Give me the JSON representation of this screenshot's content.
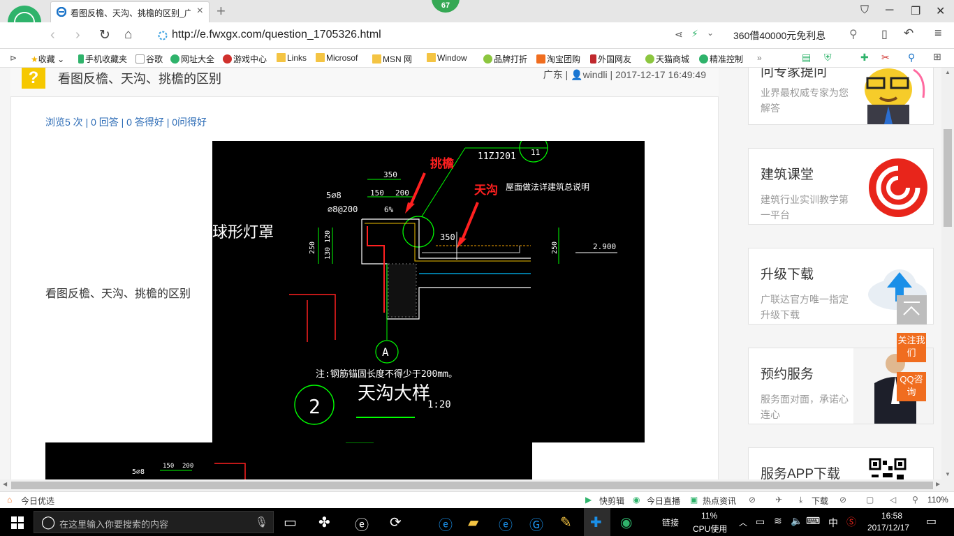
{
  "browser": {
    "tab_title": "看图反檐、天沟、挑檐的区别_广",
    "badge": "67",
    "url": "http://e.fwxgx.com/question_1705326.html",
    "search_ad": "360借40000元免利息"
  },
  "bookmarks": [
    {
      "label": "收藏"
    },
    {
      "label": "手机收藏夹"
    },
    {
      "label": "谷歌"
    },
    {
      "label": "网址大全"
    },
    {
      "label": "游戏中心"
    },
    {
      "label": "Links"
    },
    {
      "label": "Microsof"
    },
    {
      "label": "MSN 网"
    },
    {
      "label": "Window"
    },
    {
      "label": "品牌打折"
    },
    {
      "label": "淘宝团购"
    },
    {
      "label": "外国网友"
    },
    {
      "label": "天猫商城"
    },
    {
      "label": "精准控制"
    }
  ],
  "question": {
    "title": "看图反檐、天沟、挑檐的区别",
    "meta": "广东 | ",
    "author": "windli",
    "datetime": " | 2017-12-17 16:49:49",
    "stats": "浏览5 次 | 0 回答 | 0 答得好 | 0问得好",
    "body": "看图反檐、天沟、挑檐的区别"
  },
  "drawing": {
    "label_tiaoyan": "挑檐",
    "label_tiangou": "天沟",
    "note_roof": "屋面做法详建筑总说明",
    "std_ref": "11ZJ201",
    "ref_num": "11",
    "dim_350": "350",
    "dim_150": "150",
    "dim_200": "200",
    "rebar_1": "5⌀8",
    "rebar_2": "⌀8@200",
    "slope": "6%",
    "dim_120": "120",
    "dim_130": "130",
    "dim_250": "250",
    "dim_350b": "350",
    "dim_250b": "250",
    "elev": "2.900",
    "axis": "A",
    "note_anchor": "注:钢筋锚固长度不得少于200mm。",
    "detail_num": "2",
    "detail_title": "天沟大样",
    "scale": "1:20",
    "side_text": "球形灯罩",
    "b_rebar": "5⌀8",
    "b_150": "150",
    "b_200": "200"
  },
  "sidebar": {
    "expert_title": "问专家提问",
    "expert_sub": "业界最权威专家为您解答",
    "course_title": "建筑课堂",
    "course_sub": "建筑行业实训教学第一平台",
    "upgrade_title": "升级下载",
    "upgrade_sub": "广联达官方唯一指定升级下载",
    "booking_title": "预约服务",
    "booking_sub": "服务面对面，承诺心连心",
    "app_title": "服务APP下载",
    "follow_btn": "关注我们",
    "qq_btn": "QQ咨询"
  },
  "statusbar": {
    "left": "今日优选",
    "kuaijianji": "快剪辑",
    "zhibo": "今日直播",
    "news": "热点资讯",
    "download": "下载",
    "zoom": "110%"
  },
  "taskbar": {
    "search_placeholder": "在这里输入你要搜索的内容",
    "link": "链接",
    "cpu_pct": "11%",
    "cpu_label": "CPU使用",
    "ime": "中",
    "time": "16:58",
    "date": "2017/12/17"
  },
  "colors": {
    "accent_green": "#35a854",
    "orange": "#f06d1f",
    "link_blue": "#2a6ab5",
    "question_yellow": "#f6c800"
  }
}
